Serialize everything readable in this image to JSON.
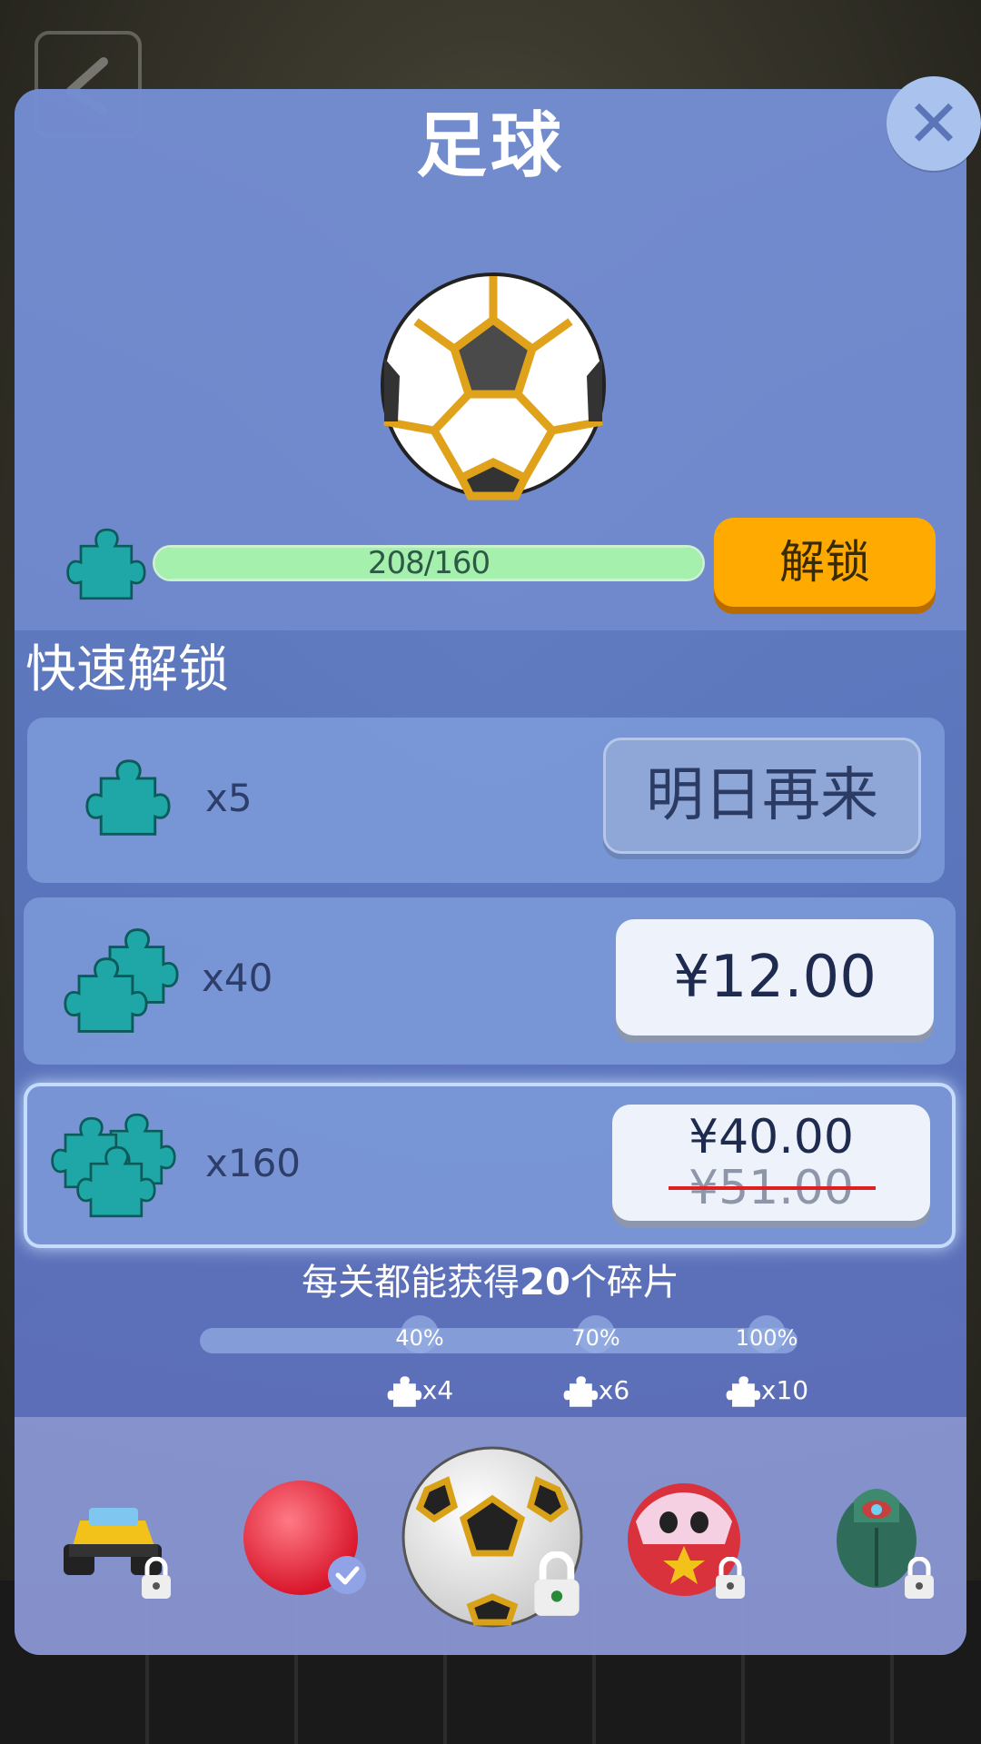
{
  "header": {
    "title": "足球"
  },
  "progress": {
    "current": 208,
    "required": 160,
    "text": "208/160",
    "fraction": 1.0
  },
  "unlock_button": {
    "label": "解锁"
  },
  "quick_unlock": {
    "title": "快速解锁",
    "offers": [
      {
        "quantity": "x5",
        "button_label": "明日再来",
        "state": "disabled"
      },
      {
        "quantity": "x40",
        "price": "¥12.00"
      },
      {
        "quantity": "x160",
        "price": "¥40.00",
        "original_price": "¥51.00"
      }
    ]
  },
  "level_reward": {
    "prefix": "每关都能获得",
    "count": "20",
    "suffix": "个碎片"
  },
  "milestones": [
    {
      "percent": "40%",
      "reward": "x4"
    },
    {
      "percent": "70%",
      "reward": "x6"
    },
    {
      "percent": "100%",
      "reward": "x10"
    }
  ],
  "skins": [
    {
      "name": "monster-truck",
      "state": "locked"
    },
    {
      "name": "red-ball",
      "state": "selected"
    },
    {
      "name": "soccer-ball",
      "state": "locked-current"
    },
    {
      "name": "clown-ball",
      "state": "locked"
    },
    {
      "name": "scarab",
      "state": "locked"
    }
  ],
  "colors": {
    "panel": "#6884cc",
    "unlock_button": "#ffaa00",
    "progress_fill": "#a6f0ae",
    "piece": "#1fa6a6",
    "strike": "#e02020"
  }
}
